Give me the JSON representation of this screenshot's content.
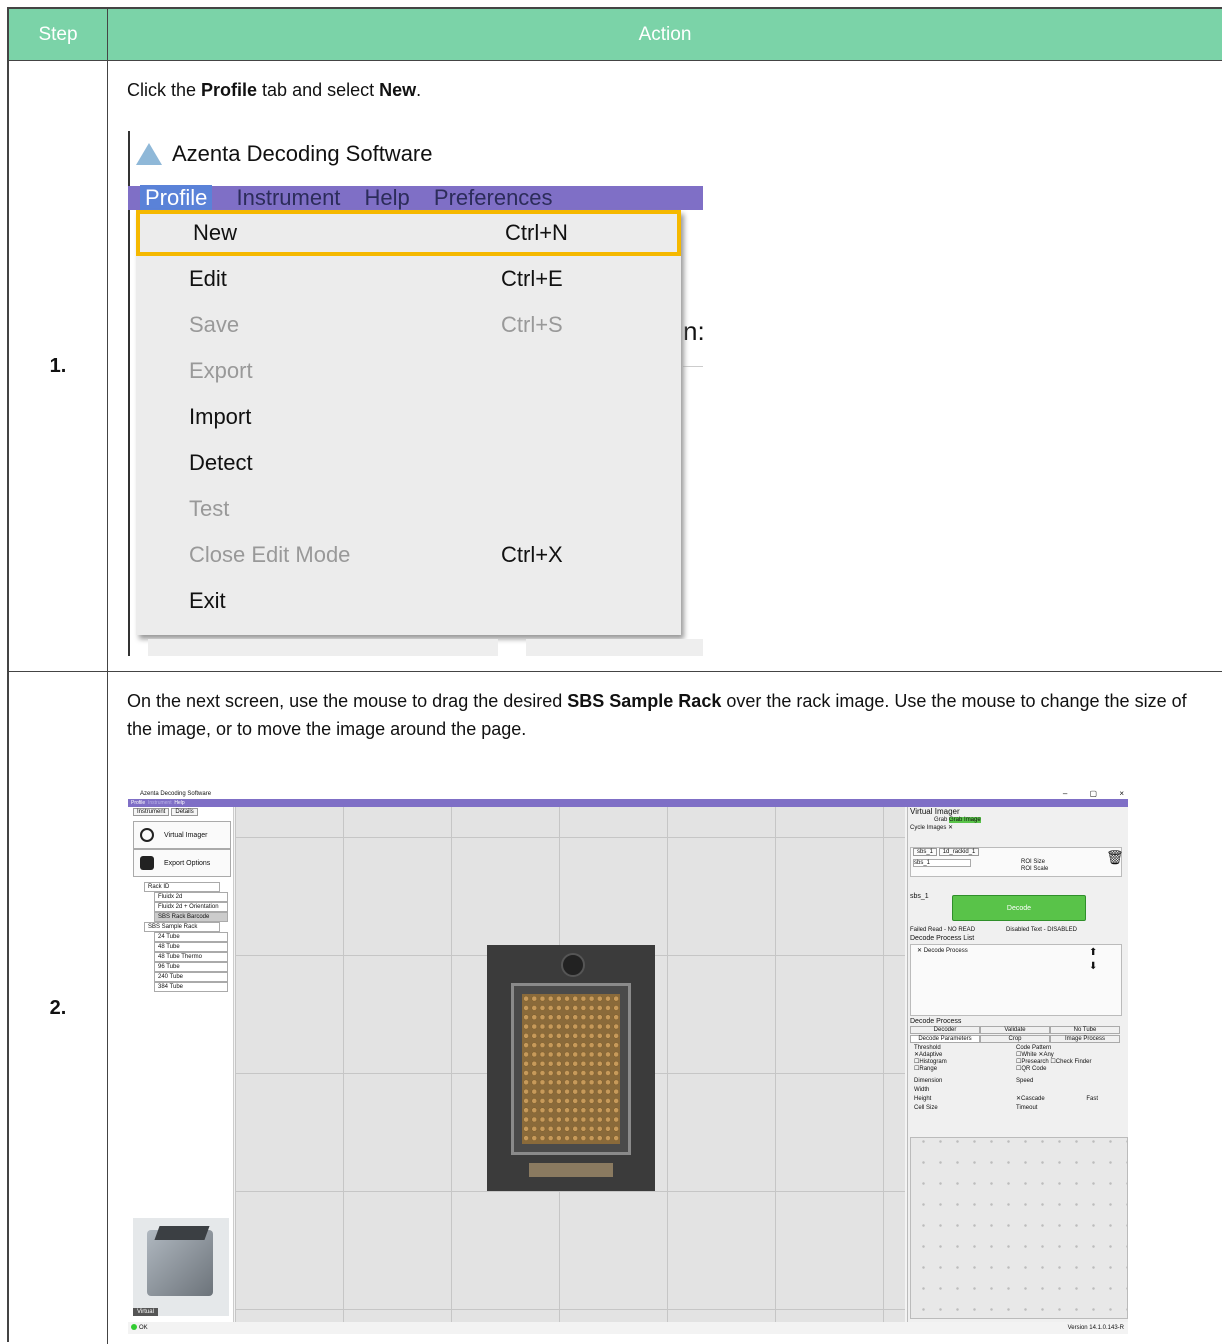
{
  "table": {
    "header_step": "Step",
    "header_action": "Action"
  },
  "row1": {
    "step": "1.",
    "text_before_profile": "Click the ",
    "profile_word": "Profile",
    "text_middle": " tab and select ",
    "new_word": "New",
    "text_end": ".",
    "screenshot": {
      "app_title": "Azenta Decoding Software",
      "menubar": [
        "Profile",
        "Instrument",
        "Help",
        "Preferences"
      ],
      "menu_items": [
        {
          "label": "New",
          "shortcut": "Ctrl+N"
        },
        {
          "label": "Edit",
          "shortcut": "Ctrl+E"
        },
        {
          "label": "Save",
          "shortcut": "Ctrl+S"
        },
        {
          "label": "Export",
          "shortcut": ""
        },
        {
          "label": "Import",
          "shortcut": ""
        },
        {
          "label": "Detect",
          "shortcut": ""
        },
        {
          "label": "Test",
          "shortcut": ""
        },
        {
          "label": "Close Edit Mode",
          "shortcut": "Ctrl+X"
        },
        {
          "label": "Exit",
          "shortcut": ""
        }
      ],
      "partial_glyph": "n:",
      "highlight_color": "#f5b800",
      "menubar_color": "#7f6fc6"
    }
  },
  "row2": {
    "step": "2.",
    "text_before": "On the next screen, use the mouse to drag the desired ",
    "bold_term": "SBS Sample Rack",
    "text_after": " over the rack image. Use the mouse to change the size of the image, or to move the image around the page.",
    "screenshot": {
      "app_title": "Azenta Decoding Software",
      "menubar": [
        "Profile",
        "Instrument",
        "Help"
      ],
      "window_buttons": "– ▢ ×",
      "left_tabs": [
        "Instrument",
        "Details"
      ],
      "buttons": [
        "Virtual Imager",
        "Export Options"
      ],
      "tree": {
        "rack_id": "Rack ID",
        "rack_children": [
          "Fluidx 2d",
          "Fluidx 2d + Orientation",
          "SBS Rack Barcode"
        ],
        "sbs": "SBS Sample Rack",
        "sbs_children": [
          "24 Tube",
          "48 Tube",
          "48 Tube Thermo",
          "96 Tube",
          "240 Tube",
          "384 Tube"
        ]
      },
      "thumb_label": "Virtual",
      "right": {
        "title": "Virtual Imager",
        "grab": "Grab",
        "grab_image": "Grab Image",
        "cycle_images": "Cycle Images",
        "tabs": [
          "sbs_1",
          "1d_rackid_1"
        ],
        "roi_field": "sbs_1",
        "roi_size": "ROI Size",
        "roi_scale": "ROI Scale",
        "profile_name": "sbs_1",
        "decode": "Decode",
        "failed_read": "Failed Read - NO READ",
        "disabled_text": "Disabled Text - DISABLED",
        "process_list_title": "Decode Process List",
        "process_item": "Decode Process",
        "decode_process_title": "Decode Process",
        "tabs_row1": [
          "Decoder",
          "Validate",
          "No Tube"
        ],
        "tabs_row2": [
          "Decode Parameters",
          "Crop",
          "Image Process"
        ],
        "threshold": "Threshold",
        "adaptive": "Adaptive",
        "histogram": "Histogram",
        "range": "Range",
        "code_pattern": "Code Pattern",
        "white": "White",
        "any": "Any",
        "presearch": "Presearch",
        "check_finder": "Check Finder",
        "qr_code": "QR Code",
        "dimension": "Dimension",
        "speed": "Speed",
        "width": "Width",
        "height": "Height",
        "cell_size": "Cell Size",
        "cascade": "Cascade",
        "fast": "Fast",
        "timeout": "Timeout"
      },
      "status_ok": "OK",
      "version": "Version 14.1.0.143-R"
    }
  }
}
